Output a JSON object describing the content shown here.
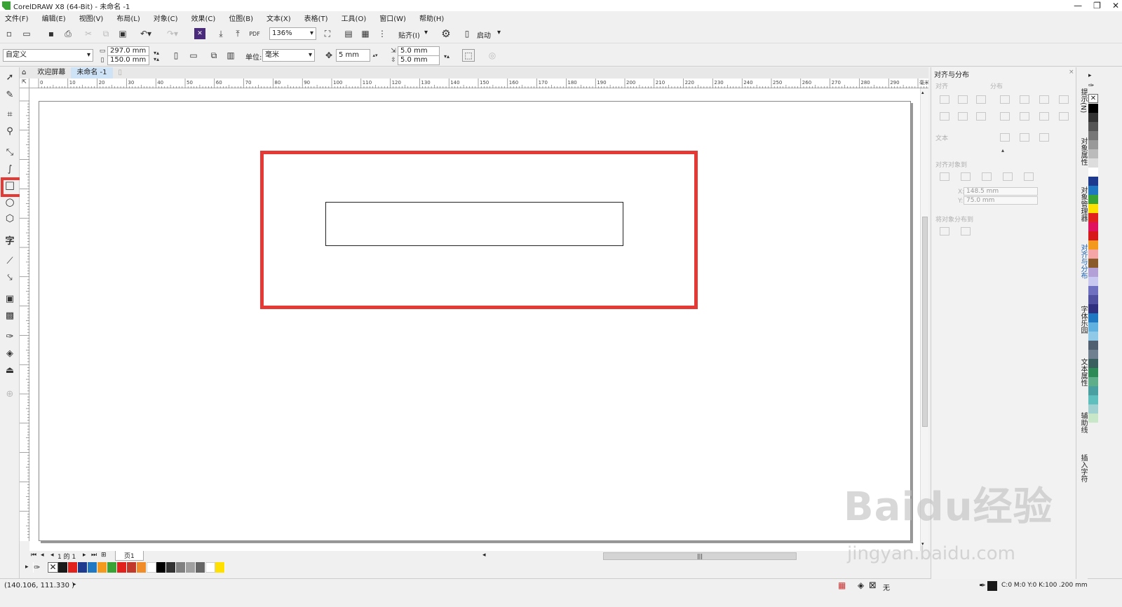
{
  "window": {
    "title": "CorelDRAW X8 (64-Bit) - 未命名 -1"
  },
  "menu": [
    "文件(F)",
    "编辑(E)",
    "视图(V)",
    "布局(L)",
    "对象(C)",
    "效果(C)",
    "位图(B)",
    "文本(X)",
    "表格(T)",
    "工具(O)",
    "窗口(W)",
    "帮助(H)"
  ],
  "toolbar": {
    "zoom": "136%",
    "snap_label": "贴齐(I)",
    "launch_label": "启动"
  },
  "propbar": {
    "page_preset": "自定义",
    "width": "297.0 mm",
    "height": "150.0 mm",
    "units_label": "单位:",
    "units_value": "毫米",
    "nudge": "5 mm",
    "dup_x": "5.0 mm",
    "dup_y": "5.0 mm"
  },
  "tabs": {
    "welcome": "欢迎屏幕",
    "doc": "未命名 -1"
  },
  "ruler_labels": [
    "0",
    "10",
    "20",
    "30",
    "40",
    "50",
    "60",
    "70",
    "80",
    "90",
    "100",
    "110",
    "120",
    "130",
    "140",
    "150",
    "160",
    "170",
    "180",
    "190",
    "200",
    "210",
    "220",
    "230",
    "240",
    "250",
    "260",
    "270",
    "280",
    "290",
    "毫米"
  ],
  "pagebar": {
    "page_count": "1 的 1",
    "page_tab": "页1"
  },
  "status": {
    "coords": "(140.106, 111.330 )",
    "fill_label": "无",
    "outline_info": "C:0 M:0 Y:0 K:100 .200 mm"
  },
  "panel": {
    "title": "对齐与分布",
    "align_label": "对齐",
    "distribute_label": "分布",
    "text_label": "文本",
    "align_objects_to": "对齐对象到",
    "x_value": "148.5 mm",
    "y_value": "75.0 mm",
    "distribute_to": "将对象分布到",
    "x_label": "X:",
    "y_label": "Y:"
  },
  "dock_tabs": [
    "提示(N)",
    "对象属性",
    "对象管理器",
    "对齐与分布",
    "字体乐园",
    "文本属性",
    "辅助线",
    "插入字符"
  ],
  "watermark": {
    "main": "Baidu经验",
    "sub": "jingyan.baidu.com"
  },
  "colors": {
    "highlight": "#e53935",
    "h_palette": [
      "#1a1a1a",
      "#e0211c",
      "#1e3a8f",
      "#1f78c1",
      "#f39a1e",
      "#3aa335",
      "#e0211c",
      "#c0392b",
      "#f08c2a",
      "#ffffff",
      "#000000",
      "#333333",
      "#808080",
      "#a0a0a0",
      "#666666",
      "#ffffff",
      "#ffe000"
    ],
    "v_palette": [
      "#000000",
      "#333333",
      "#555555",
      "#777777",
      "#999999",
      "#bbbbbb",
      "#dddddd",
      "#ffffff",
      "#1e3a8f",
      "#1f78c1",
      "#3aa335",
      "#ffe000",
      "#e0211c",
      "#e0115f",
      "#d7191c",
      "#f39a1e",
      "#f5a5a5",
      "#8b5a2b",
      "#b3a0d6",
      "#c8c8f0",
      "#7070c0",
      "#5050a0",
      "#303080",
      "#1f78c1",
      "#60b0e0",
      "#90c8e8",
      "#506070",
      "#708090",
      "#3a5f5f",
      "#2e8b57",
      "#5fae8a",
      "#4aa0a0",
      "#5fbfbf",
      "#a0d0d0",
      "#c8e6c8"
    ]
  }
}
